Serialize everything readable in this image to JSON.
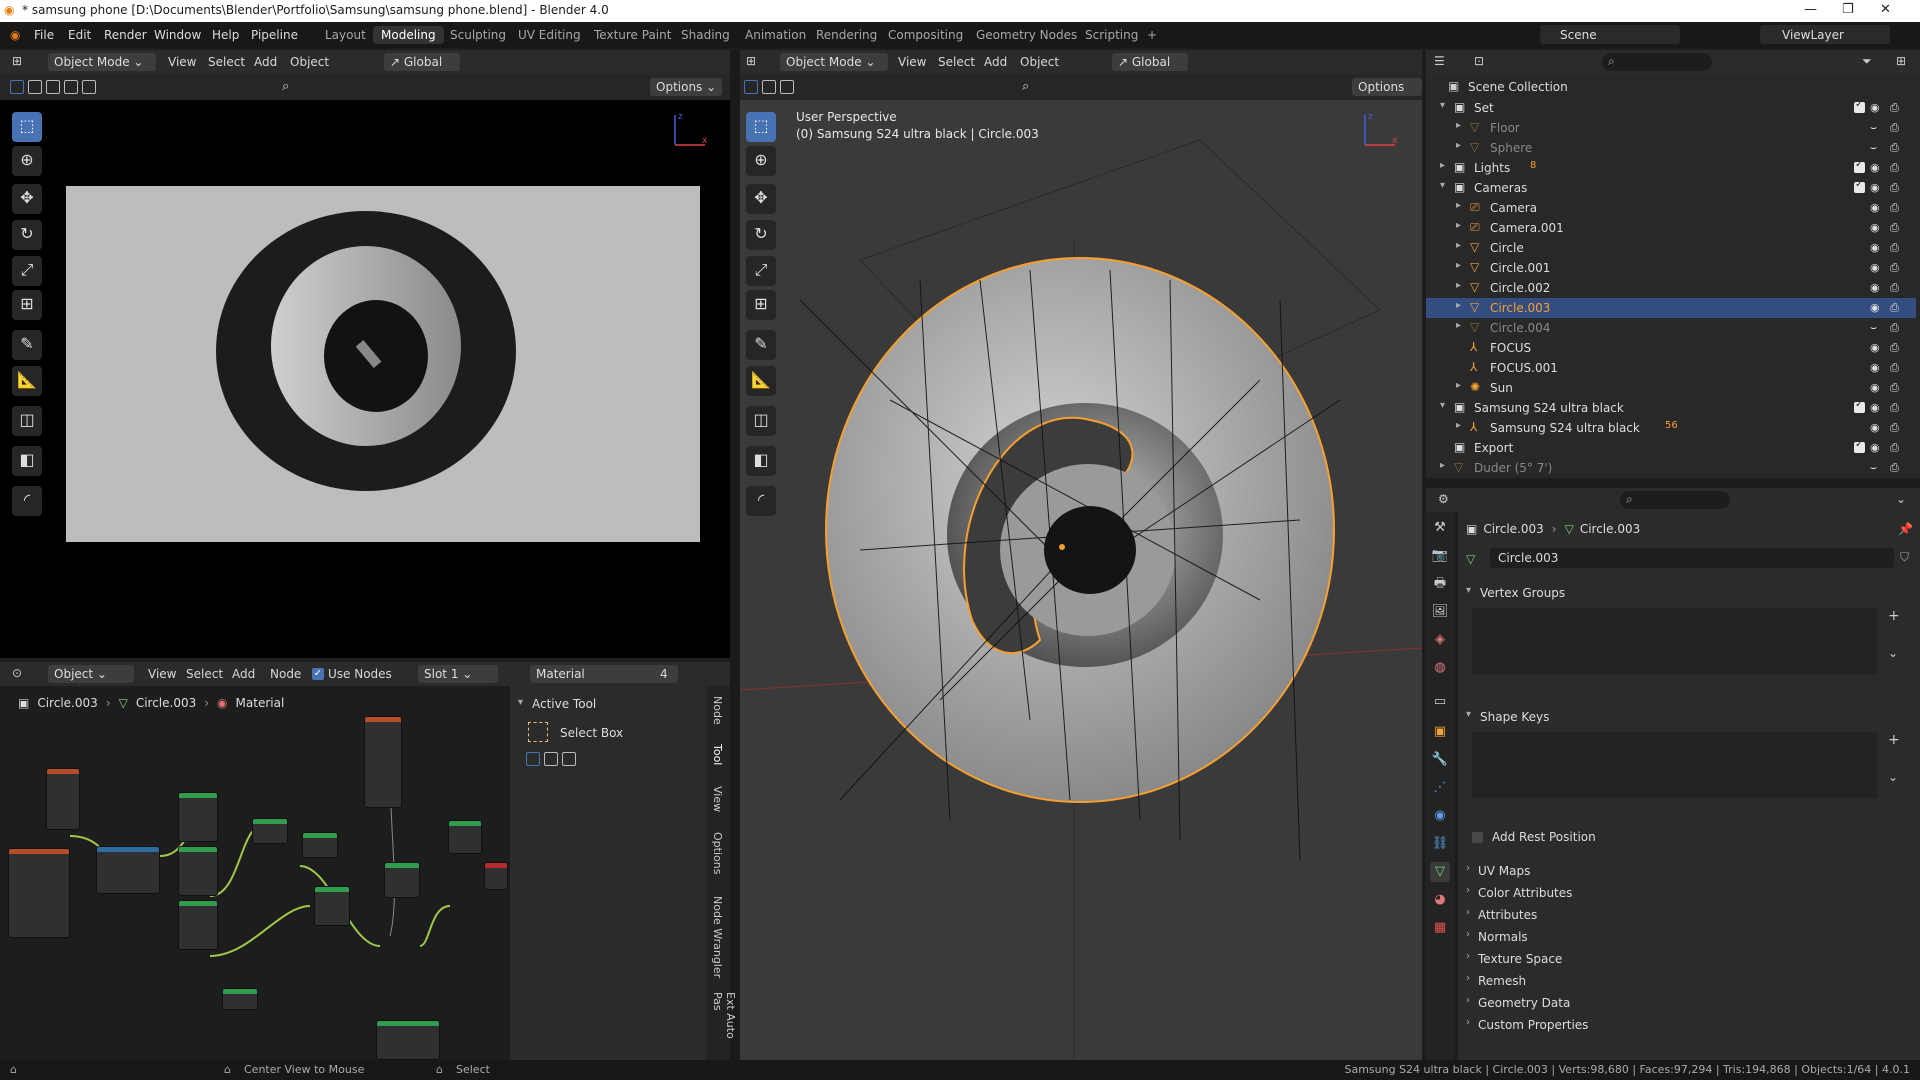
{
  "window": {
    "title": "* samsung phone [D:\\Documents\\Blender\\Portfolio\\Samsung\\samsung phone.blend] - Blender 4.0",
    "controls": [
      "—",
      "❐",
      "✕"
    ]
  },
  "menu": {
    "items": [
      "File",
      "Edit",
      "Render",
      "Window",
      "Help",
      "Pipeline"
    ],
    "workspaces": [
      "Layout",
      "Modeling",
      "Sculpting",
      "UV Editing",
      "Texture Paint",
      "Shading",
      "Animation",
      "Rendering",
      "Compositing",
      "Geometry Nodes",
      "Scripting"
    ],
    "active_workspace": "Modeling",
    "add_tab": "+",
    "scene": "Scene",
    "view_layer": "ViewLayer"
  },
  "left_view": {
    "mode": "Object Mode",
    "menus": [
      "View",
      "Select",
      "Add",
      "Object"
    ],
    "orientation": "Global",
    "options": "Options"
  },
  "right_view": {
    "mode": "Object Mode",
    "menus": [
      "View",
      "Select",
      "Add",
      "Object"
    ],
    "orientation": "Global",
    "options": "Options",
    "perspective": "User Perspective",
    "active_label": "(0) Samsung S24 ultra black | Circle.003"
  },
  "node_editor": {
    "type": "Object",
    "menus": [
      "View",
      "Select",
      "Add",
      "Node"
    ],
    "use_nodes": "Use Nodes",
    "slot": "Slot 1",
    "material": "Material",
    "users": "4",
    "breadcrumb": [
      "Circle.003",
      "Circle.003",
      "Material"
    ],
    "sidebar_tabs": [
      "Node",
      "Tool",
      "View",
      "Options",
      "Node Wrangler",
      "Ext Auto Pas"
    ],
    "active_tool_header": "Active Tool",
    "active_tool": "Select Box"
  },
  "outliner": {
    "scene_collection": "Scene Collection",
    "rows": [
      {
        "label": "Set",
        "indent": 0,
        "type": "collection",
        "check": true,
        "exp": "▾"
      },
      {
        "label": "Floor",
        "indent": 1,
        "type": "mesh",
        "dim": true,
        "exp": "▸"
      },
      {
        "label": "Sphere",
        "indent": 1,
        "type": "mesh",
        "dim": true,
        "exp": "▸"
      },
      {
        "label": "Lights",
        "indent": 0,
        "type": "collection",
        "check": true,
        "exp": "▸",
        "sub": "8"
      },
      {
        "label": "Cameras",
        "indent": 0,
        "type": "collection",
        "check": true,
        "exp": "▾"
      },
      {
        "label": "Camera",
        "indent": 1,
        "type": "camera",
        "exp": "▸"
      },
      {
        "label": "Camera.001",
        "indent": 1,
        "type": "camera",
        "exp": "▸"
      },
      {
        "label": "Circle",
        "indent": 1,
        "type": "mesh",
        "exp": "▸"
      },
      {
        "label": "Circle.001",
        "indent": 1,
        "type": "mesh",
        "exp": "▸"
      },
      {
        "label": "Circle.002",
        "indent": 1,
        "type": "mesh",
        "exp": "▸"
      },
      {
        "label": "Circle.003",
        "indent": 1,
        "type": "mesh",
        "selected": true,
        "exp": "▸"
      },
      {
        "label": "Circle.004",
        "indent": 1,
        "type": "mesh",
        "dim": true,
        "exp": "▸"
      },
      {
        "label": "FOCUS",
        "indent": 1,
        "type": "empty",
        "exp": ""
      },
      {
        "label": "FOCUS.001",
        "indent": 1,
        "type": "empty",
        "exp": ""
      },
      {
        "label": "Sun",
        "indent": 1,
        "type": "light",
        "exp": "▸"
      },
      {
        "label": "Samsung S24 ultra black",
        "indent": 0,
        "type": "collection",
        "check": true,
        "exp": "▾"
      },
      {
        "label": "Samsung S24 ultra black",
        "indent": 1,
        "type": "empty",
        "exp": "▸",
        "sub": "56"
      },
      {
        "label": "Export",
        "indent": 0,
        "type": "collection",
        "check": true,
        "exp": ""
      },
      {
        "label": "Duder (5° 7')",
        "indent": 0,
        "type": "mesh",
        "dim": true,
        "exp": "▸"
      }
    ]
  },
  "properties": {
    "breadcrumb_obj": "Circle.003",
    "breadcrumb_data": "Circle.003",
    "data_name": "Circle.003",
    "sections_open": [
      "Vertex Groups",
      "Shape Keys"
    ],
    "add_rest_position": "Add Rest Position",
    "sections": [
      "UV Maps",
      "Color Attributes",
      "Attributes",
      "Normals",
      "Texture Space",
      "Remesh",
      "Geometry Data",
      "Custom Properties"
    ]
  },
  "status": {
    "left": "Center View to Mouse",
    "mid": "Select",
    "right": "Samsung S24 ultra black | Circle.003 | Verts:98,680 | Faces:97,294 | Tris:194,868 | Objects:1/64 | 4.0.1"
  },
  "colors": {
    "selected_outline": "#f5a030",
    "active_row": "#334d80",
    "accent": "#4772b3"
  }
}
